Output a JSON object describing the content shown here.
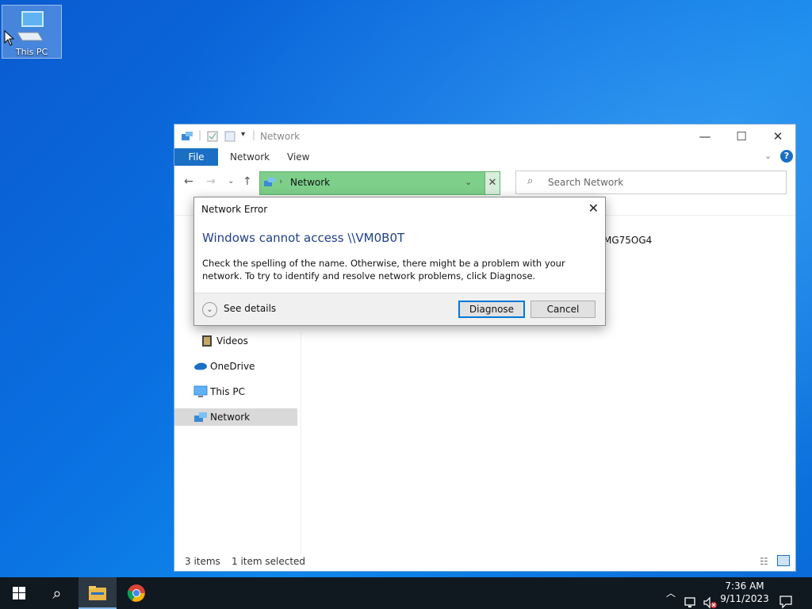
{
  "desktop": {
    "icon_label": "This PC"
  },
  "explorer": {
    "title": "Network",
    "ribbon_tabs": [
      "File",
      "Network",
      "View"
    ],
    "address": "Network",
    "search_placeholder": "Search Network",
    "sidebar": [
      {
        "label": "Videos",
        "icon": "videos-icon"
      },
      {
        "label": "OneDrive",
        "icon": "onedrive-icon"
      },
      {
        "label": "This PC",
        "icon": "this-pc-icon"
      },
      {
        "label": "Network",
        "icon": "network-icon",
        "selected": true
      }
    ],
    "content_item": "MG75OG4",
    "status": {
      "items": "3 items",
      "selected": "1 item selected"
    }
  },
  "dialog": {
    "title": "Network Error",
    "heading": "Windows cannot access \\\\VM0B0T",
    "body": "Check the spelling of the name. Otherwise, there might be a problem with your network. To try to identify and resolve network problems, click Diagnose.",
    "see_details": "See details",
    "diagnose": "Diagnose",
    "cancel": "Cancel"
  },
  "taskbar": {
    "time": "7:36 AM",
    "date": "9/11/2023"
  },
  "colors": {
    "accent": "#0078d7",
    "address_bar": "#7dcf8a",
    "taskbar": "#101820"
  }
}
